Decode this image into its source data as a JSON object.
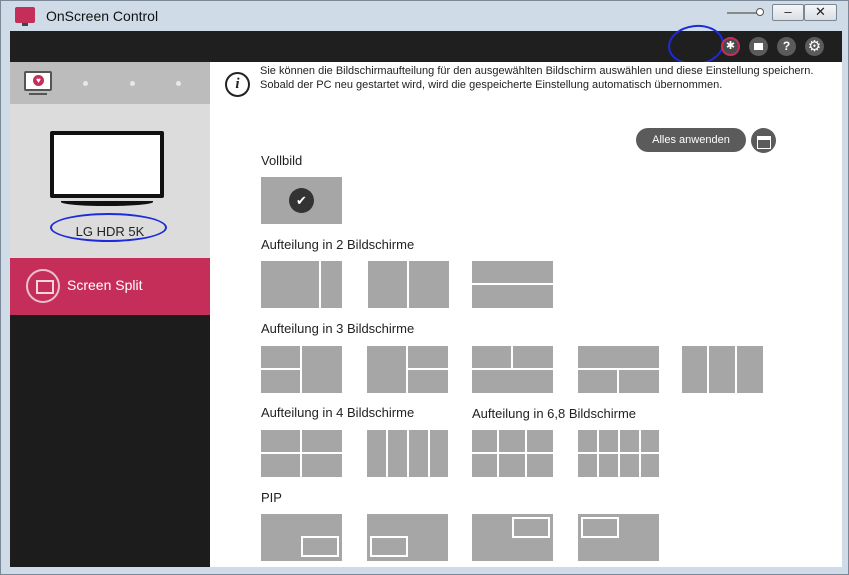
{
  "window": {
    "title": "OnScreen Control",
    "min_label": "–",
    "close_label": "✕",
    "brightness_level": 0.85
  },
  "toolbar": {
    "icons": [
      "cursor-icon",
      "window-icon",
      "help-icon",
      "gear-icon"
    ],
    "help_glyph": "?",
    "gear_glyph": "⚙",
    "cursor_glyph": "✱"
  },
  "sidebar": {
    "monitor_name": "LG HDR 5K",
    "menu_item": "Screen Split"
  },
  "content": {
    "info_text": "Sie können die Bildschirmaufteilung für den ausgewählten Bildschirm auswählen und diese Einstellung speichern. Sobald der PC neu gestartet wird, wird die gespeicherte Einstellung automatisch übernommen.",
    "info_glyph": "i",
    "apply_all": "Alles anwenden",
    "sections": {
      "full": "Vollbild",
      "split2": "Aufteilung in 2 Bildschirme",
      "split3": "Aufteilung in 3 Bildschirme",
      "split4": "Aufteilung in 4 Bildschirme",
      "split68": "Aufteilung in 6,8 Bildschirme",
      "pip": "PIP"
    },
    "selected_glyph": "✔"
  },
  "colors": {
    "accent": "#c42e58",
    "toolbar_bg": "#1f1f1f",
    "tile": "#a6a6a6",
    "annotation": "#1e2bd8"
  }
}
